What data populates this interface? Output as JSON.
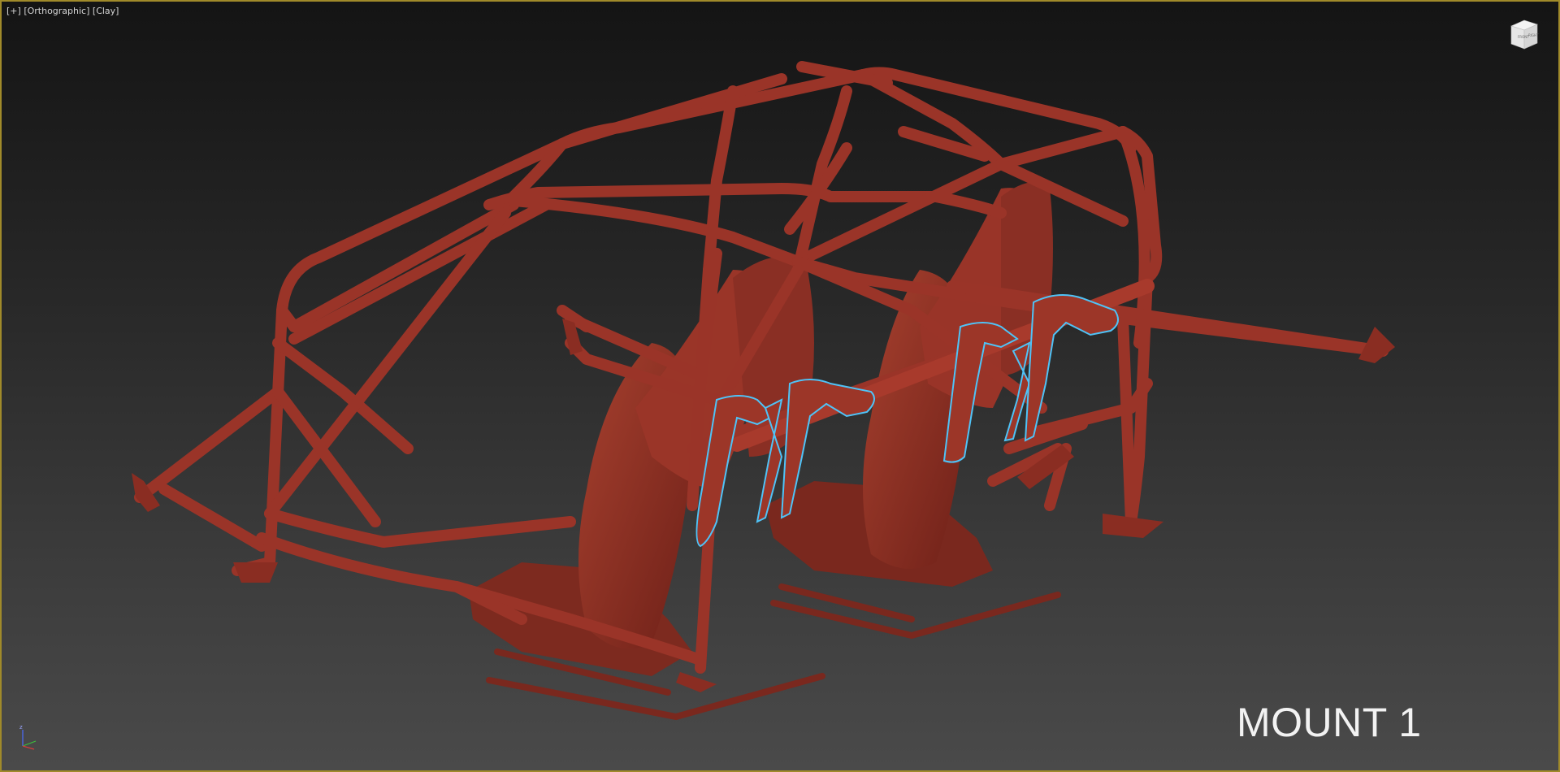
{
  "viewport": {
    "menu_label": "[+]",
    "view_label": "[Orthographic]",
    "shading_label": "[Clay]",
    "border_color": "#a08a2a"
  },
  "viewcube": {
    "front_label": "FRONT",
    "right_label": "RIGHT",
    "icon": "viewcube-icon"
  },
  "scene": {
    "object": "roll-cage",
    "material_color": "#9a3428",
    "selection_color": "#4fc3f7",
    "title": "MOUNT 1"
  },
  "axis": {
    "z_label": "z",
    "colors": {
      "x": "#d23c3c",
      "y": "#3cbf3c",
      "z": "#4a6cff"
    }
  }
}
